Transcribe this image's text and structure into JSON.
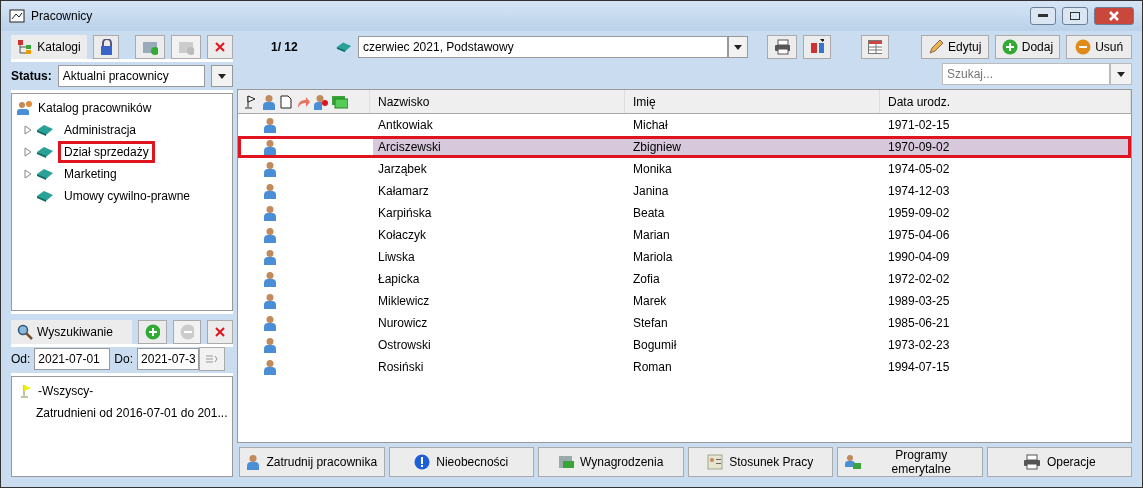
{
  "window": {
    "title": "Pracownicy"
  },
  "catalog_toolbar": {
    "label": "Katalogi"
  },
  "status": {
    "label": "Status:",
    "value": "Aktualni pracownicy"
  },
  "tree": {
    "label": "Katalog pracowników",
    "children": [
      {
        "label": "Administracja",
        "expandable": true,
        "selected": false
      },
      {
        "label": "Dział sprzedaży",
        "expandable": true,
        "selected": true
      },
      {
        "label": "Marketing",
        "expandable": true,
        "selected": false
      },
      {
        "label": "Umowy cywilno-prawne",
        "expandable": false,
        "selected": false
      }
    ]
  },
  "search_panel": {
    "label": "Wyszukiwanie",
    "from_label": "Od:",
    "from": "2021-07-01",
    "to_label": "Do:",
    "to": "2021-07-3",
    "items": [
      {
        "label": "-Wszyscy-",
        "kind": "flag"
      },
      {
        "label": "Zatrudnieni od 2016-07-01 do 201...",
        "kind": "plain"
      }
    ]
  },
  "pager": "1/ 12",
  "period": "czerwiec 2021, Podstawowy",
  "actions": [
    "Edytuj",
    "Dodaj",
    "Usuń"
  ],
  "search": {
    "placeholder": "Szukaj..."
  },
  "table": {
    "columns": [
      "Nazwisko",
      "Imię",
      "Data urodz."
    ],
    "rows": [
      {
        "cells": [
          "Antkowiak",
          "Michał",
          "1971-02-15"
        ],
        "selected": false
      },
      {
        "cells": [
          "Arciszewski",
          "Zbigniew",
          "1970-09-02"
        ],
        "selected": true
      },
      {
        "cells": [
          "Jarząbek",
          "Monika",
          "1974-05-02"
        ],
        "selected": false
      },
      {
        "cells": [
          "Kałamarz",
          "Janina",
          "1974-12-03"
        ],
        "selected": false
      },
      {
        "cells": [
          "Karpińska",
          "Beata",
          "1959-09-02"
        ],
        "selected": false
      },
      {
        "cells": [
          "Kołaczyk",
          "Marian",
          "1975-04-06"
        ],
        "selected": false
      },
      {
        "cells": [
          "Liwska",
          "Mariola",
          "1990-04-09"
        ],
        "selected": false
      },
      {
        "cells": [
          "Łapicka",
          "Zofia",
          "1972-02-02"
        ],
        "selected": false
      },
      {
        "cells": [
          "Miklewicz",
          "Marek",
          "1989-03-25"
        ],
        "selected": false
      },
      {
        "cells": [
          "Nurowicz",
          "Stefan",
          "1985-06-21"
        ],
        "selected": false
      },
      {
        "cells": [
          "Ostrowski",
          "Bogumił",
          "1973-02-23"
        ],
        "selected": false
      },
      {
        "cells": [
          "Rosiński",
          "Roman",
          "1994-07-15"
        ],
        "selected": false
      }
    ]
  },
  "bottom_buttons": [
    {
      "label": "Zatrudnij pracownika",
      "kind": "person"
    },
    {
      "label": "Nieobecności",
      "kind": "info"
    },
    {
      "label": "Wynagrodzenia",
      "kind": "money"
    },
    {
      "label": "Stosunek Pracy",
      "kind": "card"
    },
    {
      "label": "Programy emerytalne",
      "kind": "people"
    },
    {
      "label": "Operacje",
      "kind": "printer"
    }
  ]
}
